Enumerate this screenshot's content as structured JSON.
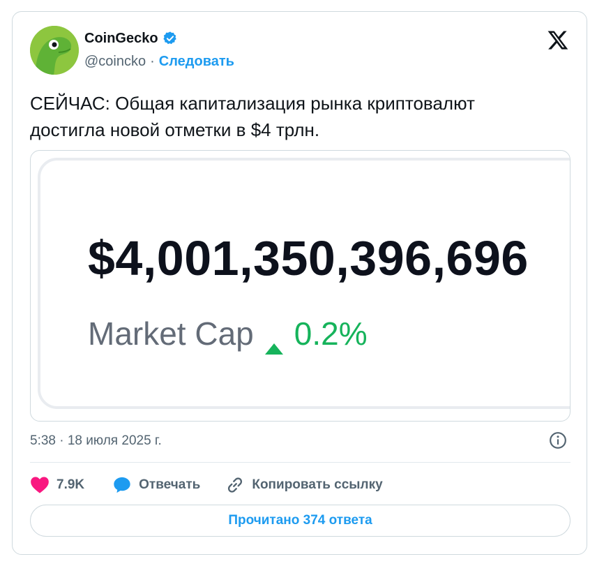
{
  "author": {
    "name": "CoinGecko",
    "handle": "@coincko",
    "separator": "·",
    "follow_label": "Следовать",
    "verified": true,
    "avatar_icon": "coingecko-gecko-logo"
  },
  "platform_icon": "x-logo",
  "tweet": {
    "text_line1": "СЕЙЧАС: Общая капитализация рынка криптовалют",
    "text_line2": "достигла новой отметки в $4 трлн."
  },
  "media": {
    "value": "$4,001,350,396,696",
    "label": "Market Cap",
    "change": "0.2%",
    "change_direction": "up",
    "change_color": "#16b35b"
  },
  "meta": {
    "timestamp": "5:38 · 18 июля 2025 г.",
    "info_icon": "info-icon"
  },
  "actions": {
    "like_count": "7.9K",
    "reply_label": "Отвечать",
    "copy_label": "Копировать ссылку"
  },
  "read_replies_label": "Прочитано 374 ответа",
  "colors": {
    "accent": "#1d9bf0",
    "like": "#f91880",
    "text": "#0f1419",
    "secondary": "#536471"
  }
}
